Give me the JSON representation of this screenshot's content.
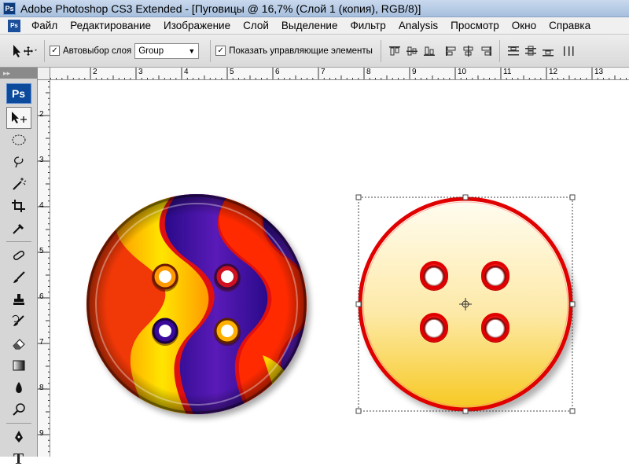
{
  "window": {
    "title": "Adobe Photoshop CS3 Extended - [Пуговицы @ 16,7% (Слой 1 (копия), RGB/8)]",
    "app_icon": "Ps"
  },
  "menu": {
    "app_icon": "Ps",
    "items": [
      "Файл",
      "Редактирование",
      "Изображение",
      "Слой",
      "Выделение",
      "Фильтр",
      "Analysis",
      "Просмотр",
      "Окно",
      "Справка"
    ]
  },
  "options": {
    "auto_select_label": "Автовыбор слоя",
    "auto_select_checked": true,
    "auto_select_value": "Group",
    "show_controls_label": "Показать управляющие элементы",
    "show_controls_checked": true,
    "align_icons": [
      "align-top-icon",
      "align-vcenter-icon",
      "align-bottom-icon",
      "align-left-icon",
      "align-hcenter-icon",
      "align-right-icon",
      "distribute-top-icon",
      "distribute-vcenter-icon",
      "distribute-bottom-icon",
      "distribute-left-icon"
    ]
  },
  "toolbox": {
    "logo": "Ps",
    "tools": [
      "move-tool",
      "marquee-tool",
      "lasso-tool",
      "magic-wand-tool",
      "crop-tool",
      "eyedropper-tool",
      "healing-tool",
      "brush-tool",
      "stamp-tool",
      "history-brush-tool",
      "eraser-tool",
      "gradient-tool",
      "blur-tool",
      "dodge-tool",
      "pen-tool",
      "type-tool"
    ],
    "active_tool": "move-tool"
  },
  "ruler": {
    "top_labels": [
      "2",
      "3",
      "4",
      "5",
      "6",
      "7",
      "8",
      "9",
      "10",
      "11",
      "12",
      "13"
    ],
    "left_labels": [
      "2",
      "3",
      "4",
      "5",
      "6",
      "7",
      "8",
      "9"
    ]
  },
  "colors": {
    "button_left_red": "#e01010",
    "button_left_blue": "#3a0e9a",
    "button_left_yellow": "#ffd400",
    "button_right_rim": "#e00000",
    "button_right_fill_top": "#fffbe8",
    "button_right_fill_bottom": "#f7cf2a"
  }
}
